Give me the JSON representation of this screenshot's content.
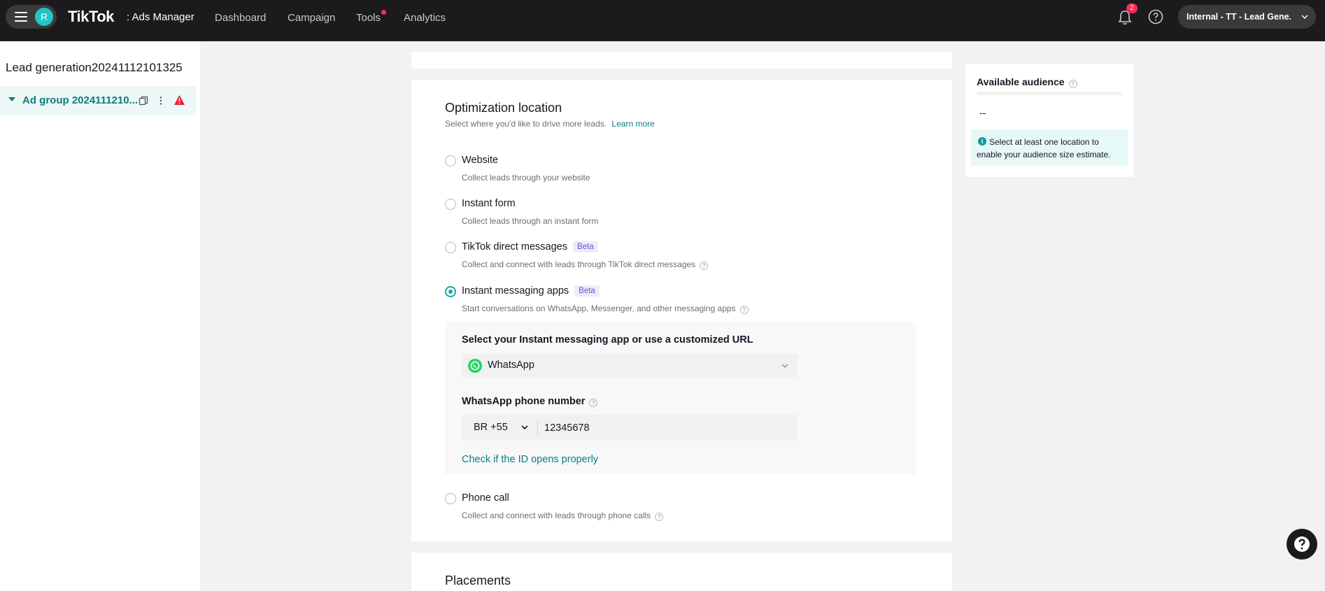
{
  "header": {
    "avatar_initial": "R",
    "brand": "TikTok",
    "brand_sub": ": Ads Manager",
    "nav": [
      "Dashboard",
      "Campaign",
      "Tools",
      "Analytics"
    ],
    "notification_count": "2",
    "account_name": "Internal - TT - Lead Gene..."
  },
  "sidebar": {
    "campaign_name": "Lead generation20241112101325",
    "ad_group_label": "Ad group 2024111210..."
  },
  "optimization": {
    "title": "Optimization location",
    "subtitle": "Select where you'd like to drive more leads.",
    "learn_more": "Learn more",
    "options": [
      {
        "label": "Website",
        "desc": "Collect leads through your website",
        "selected": false
      },
      {
        "label": "Instant form",
        "desc": "Collect leads through an instant form",
        "selected": false
      },
      {
        "label": "TikTok direct messages",
        "badge": "Beta",
        "desc": "Collect and connect with leads through TikTok direct messages",
        "selected": false
      },
      {
        "label": "Instant messaging apps",
        "badge": "Beta",
        "desc": "Start conversations on WhatsApp, Messenger, and other messaging apps",
        "selected": true
      },
      {
        "label": "Phone call",
        "desc": "Collect and connect with leads through phone calls",
        "selected": false
      }
    ],
    "messaging": {
      "title": "Select your Instant messaging app or use a customized URL",
      "app": "WhatsApp",
      "phone_label": "WhatsApp phone number",
      "country_code": "BR +55",
      "phone_value": "12345678",
      "check_link": "Check if the ID opens properly"
    }
  },
  "placements": {
    "title": "Placements"
  },
  "audience": {
    "title": "Available audience",
    "value": "--",
    "note": "Select at least one location to enable your audience size estimate."
  },
  "colors": {
    "accent": "#0b7d80",
    "radio": "#12a8a8",
    "beta": "#6c55c8",
    "alert": "#fe2c55"
  }
}
